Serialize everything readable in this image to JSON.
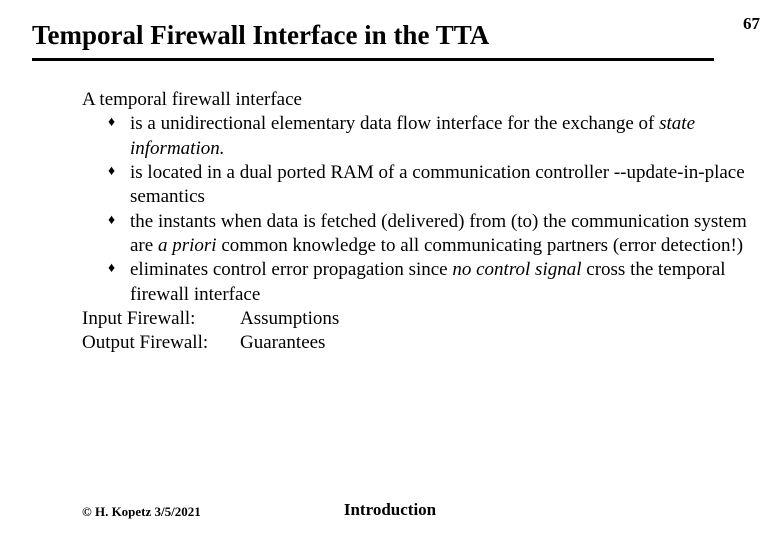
{
  "page_number": "67",
  "title": "Temporal Firewall Interface in the TTA",
  "intro": "A temporal firewall interface",
  "bullets": [
    {
      "pre": "is a unidirectional elementary data flow interface for the exchange of ",
      "em": "state  information.",
      "post": ""
    },
    {
      "pre": "is located in a dual ported RAM of a communication controller --update-in-place semantics",
      "em": "",
      "post": ""
    },
    {
      "pre": "the instants when data is fetched (delivered) from (to) the communication  system are ",
      "em": "a priori",
      "post": " common knowledge to all communicating partners (error detection!)"
    },
    {
      "pre": "eliminates control error propagation since ",
      "em": "no control signal",
      "post": " cross the temporal firewall  interface"
    }
  ],
  "post_lines": [
    {
      "label": "Input Firewall:",
      "value": "Assumptions"
    },
    {
      "label": "Output Firewall:",
      "value": "Guarantees"
    }
  ],
  "footer_left": "© H. Kopetz  3/5/2021",
  "footer_center": "Introduction"
}
